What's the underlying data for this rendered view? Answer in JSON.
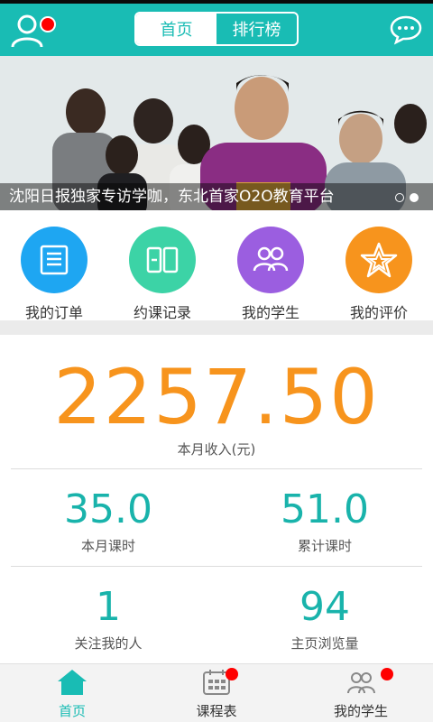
{
  "colors": {
    "primary": "#19bcb4",
    "accent": "#f7941d",
    "badge": "#ff0000"
  },
  "topbar": {
    "tabs": [
      {
        "label": "首页",
        "active": true
      },
      {
        "label": "排行榜",
        "active": false
      }
    ],
    "avatar_icon": "user-avatar-icon",
    "chat_icon": "chat-bubble-icon"
  },
  "banner": {
    "caption": "沈阳日报独家专访学咖，东北首家O2O教育平台",
    "page_count": 2,
    "active_page": 2
  },
  "quick_actions": [
    {
      "label": "我的订单",
      "icon": "order-list-icon",
      "color": "#1ea6f2"
    },
    {
      "label": "约课记录",
      "icon": "course-record-icon",
      "color": "#3cd3a6"
    },
    {
      "label": "我的学生",
      "icon": "students-icon",
      "color": "#9b5ee0"
    },
    {
      "label": "我的评价",
      "icon": "star-rating-icon",
      "color": "#f7941d"
    }
  ],
  "stats": {
    "monthly_income": {
      "value": "2257.50",
      "label": "本月收入(元)"
    },
    "items": [
      {
        "value": "35.0",
        "label": "本月课时"
      },
      {
        "value": "51.0",
        "label": "累计课时"
      },
      {
        "value": "1",
        "label": "关注我的人"
      },
      {
        "value": "94",
        "label": "主页浏览量"
      }
    ]
  },
  "bottom_nav": [
    {
      "label": "首页",
      "icon": "home-icon",
      "active": true,
      "badge": false
    },
    {
      "label": "课程表",
      "icon": "calendar-icon",
      "active": false,
      "badge": true
    },
    {
      "label": "我的学生",
      "icon": "students-icon",
      "active": false,
      "badge": true
    }
  ]
}
